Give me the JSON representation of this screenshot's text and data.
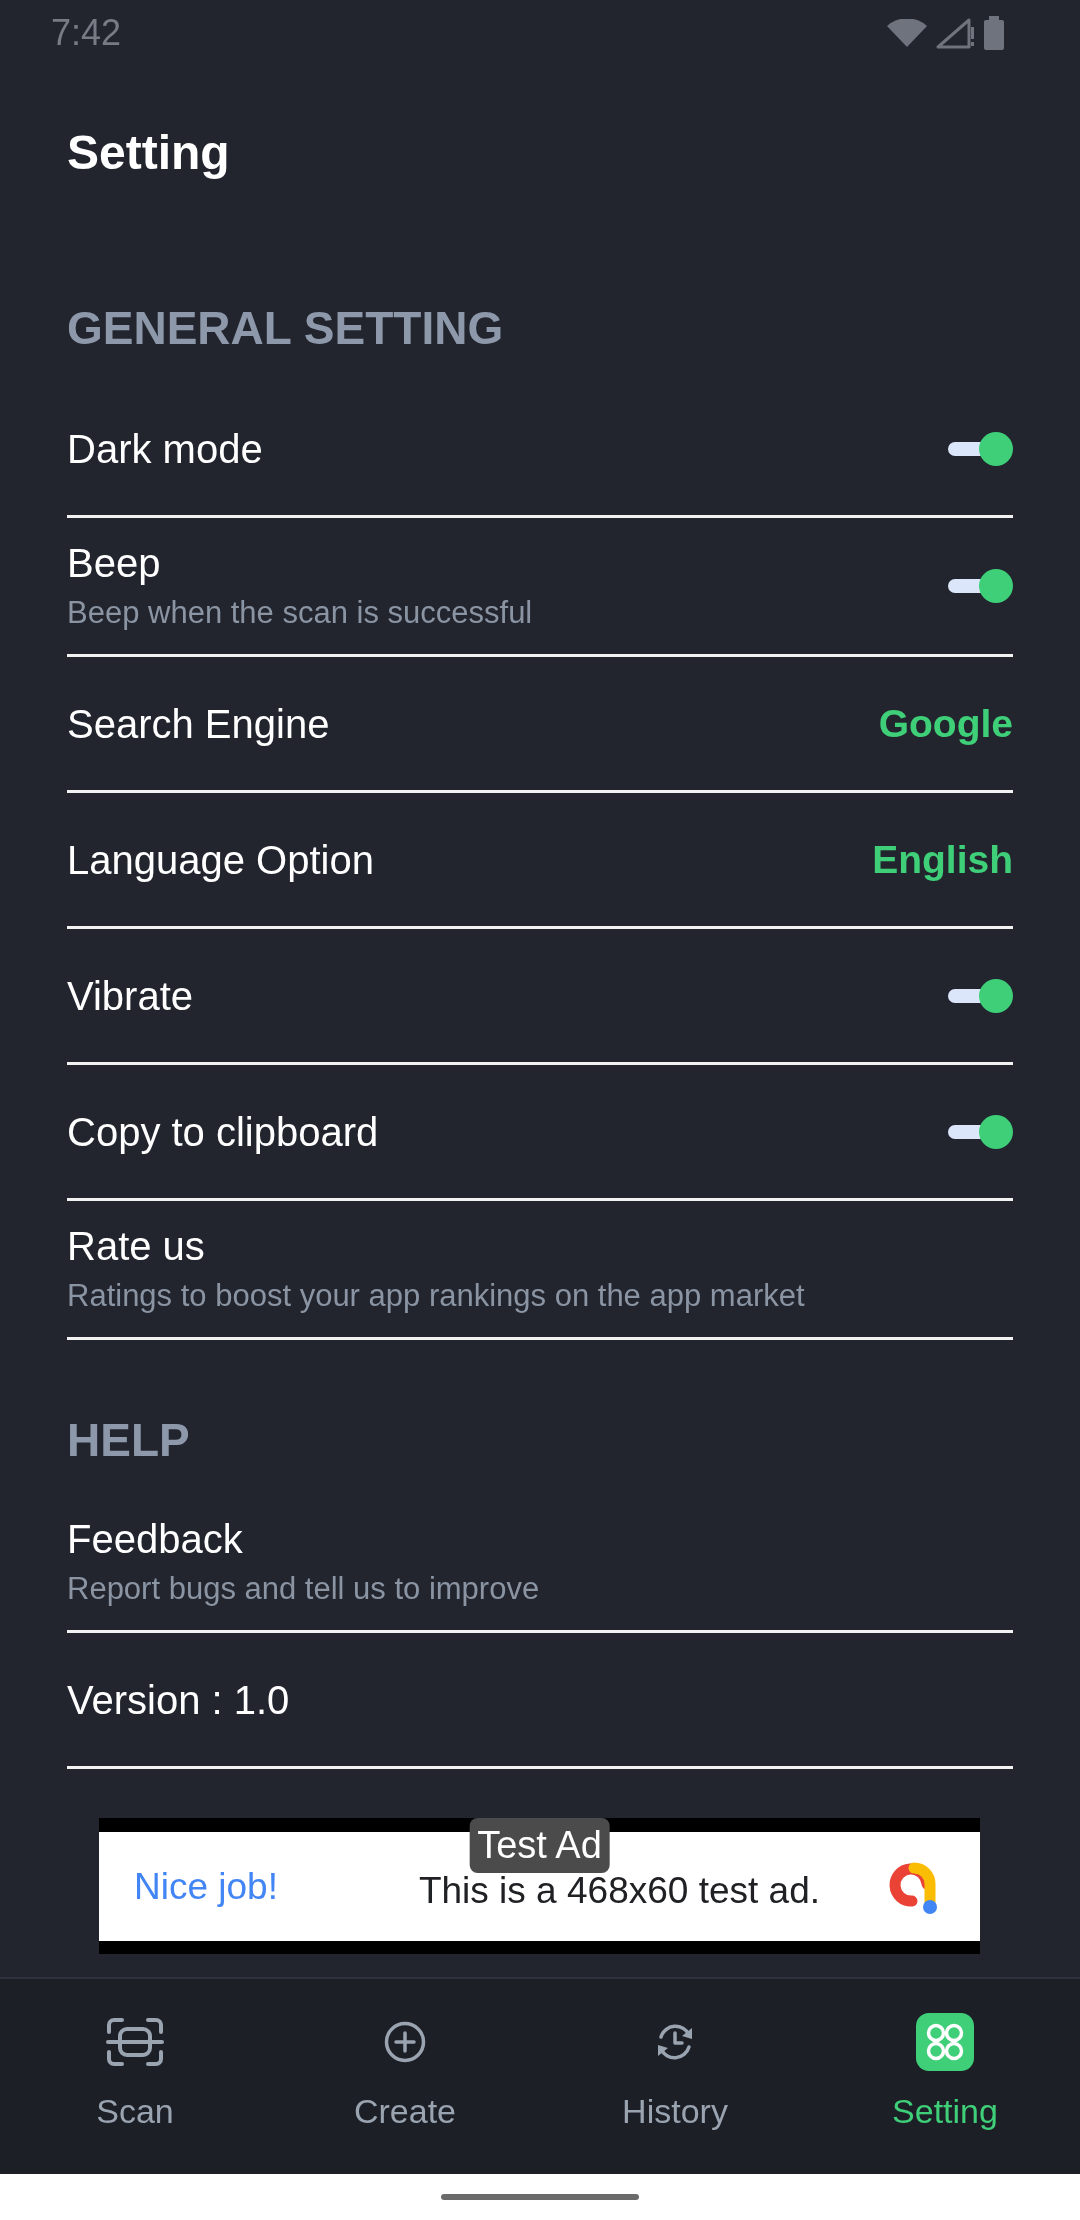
{
  "status_bar": {
    "time": "7:42"
  },
  "header": {
    "title": "Setting"
  },
  "sections": [
    {
      "title": "GENERAL SETTING",
      "items": [
        {
          "kind": "toggle",
          "label": "Dark mode",
          "on": true
        },
        {
          "kind": "toggle",
          "label": "Beep",
          "description": "Beep when the scan is successful",
          "on": true
        },
        {
          "kind": "value",
          "label": "Search Engine",
          "value": "Google"
        },
        {
          "kind": "value",
          "label": "Language Option",
          "value": "English"
        },
        {
          "kind": "toggle",
          "label": "Vibrate",
          "on": true
        },
        {
          "kind": "toggle",
          "label": "Copy to clipboard",
          "on": true
        },
        {
          "kind": "text",
          "label": "Rate us",
          "description": "Ratings to boost your app rankings on the app market"
        }
      ]
    },
    {
      "title": "HELP",
      "items": [
        {
          "kind": "text",
          "label": "Feedback",
          "description": "Report bugs and tell us to improve"
        },
        {
          "kind": "text",
          "label": "Version : 1.0"
        }
      ]
    }
  ],
  "ad": {
    "badge": "Test Ad",
    "headline": "Nice job!",
    "text": "This is a 468x60 test ad."
  },
  "bottom_nav": [
    {
      "label": "Scan",
      "selected": false
    },
    {
      "label": "Create",
      "selected": false
    },
    {
      "label": "History",
      "selected": false
    },
    {
      "label": "Setting",
      "selected": true
    }
  ]
}
